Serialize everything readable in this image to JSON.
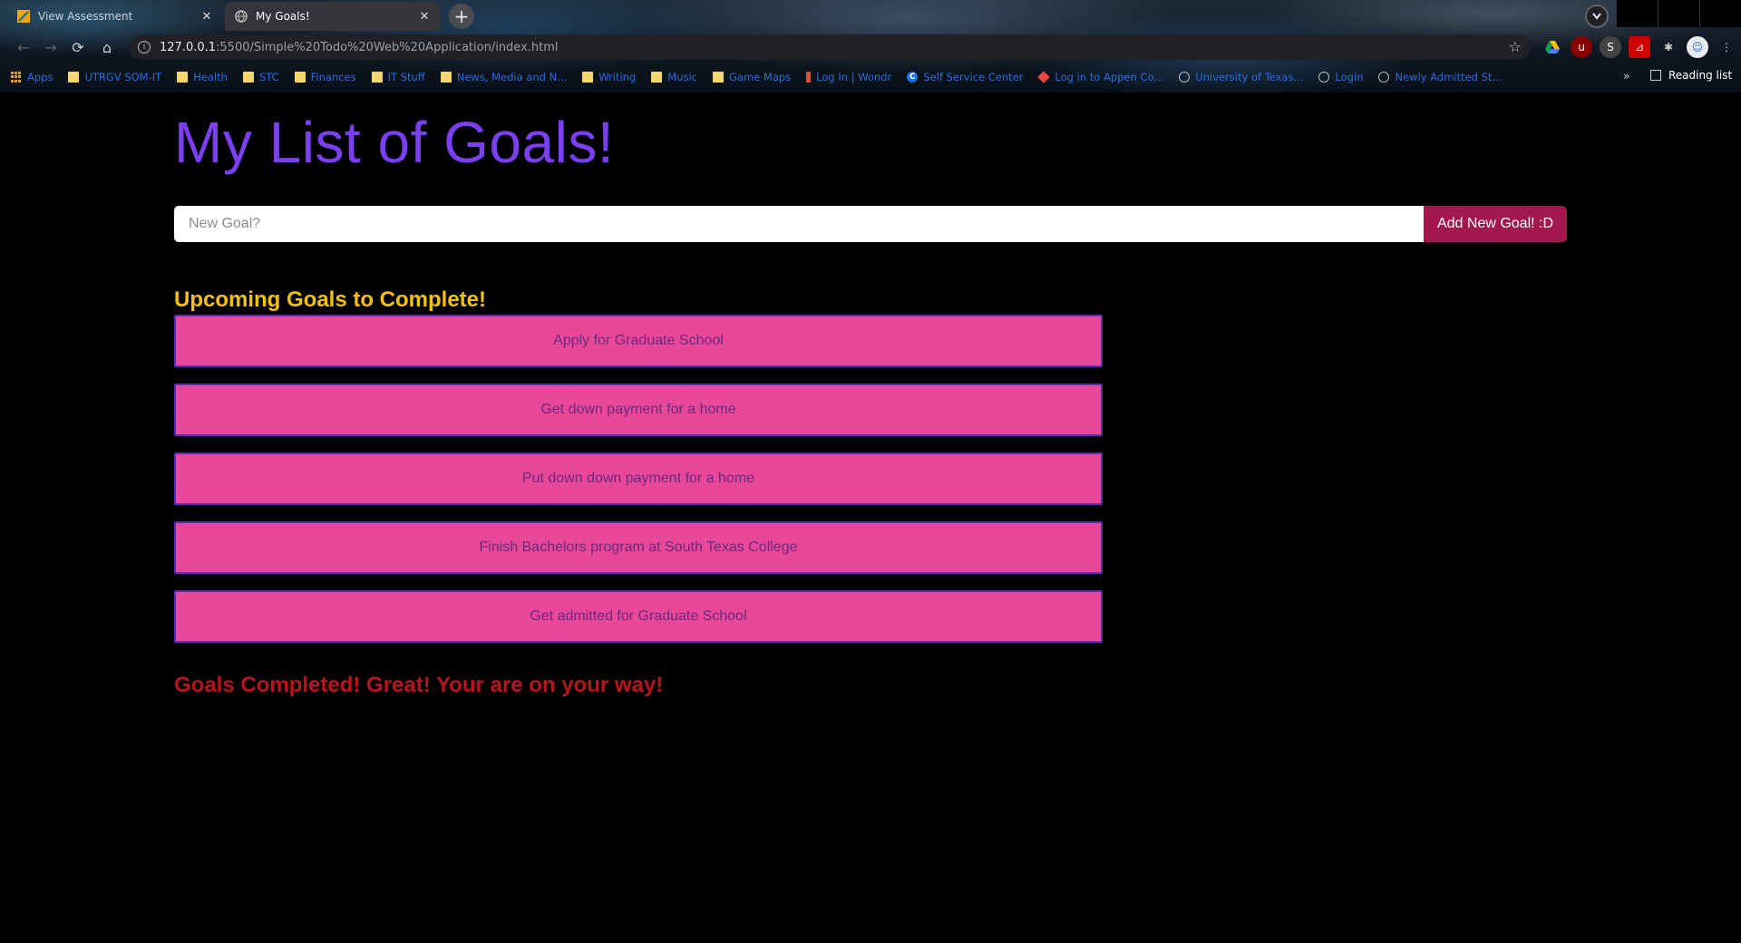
{
  "browser": {
    "tabs": [
      {
        "title": "View Assessment",
        "active": false,
        "icon": "assessment-favicon"
      },
      {
        "title": "My Goals!",
        "active": true,
        "icon": "globe-favicon"
      }
    ],
    "url_host": "127.0.0.1",
    "url_rest": ":5500/Simple%20Todo%20Web%20Application/index.html",
    "bookmarks": [
      {
        "label": "Apps",
        "icon": "apps-grid"
      },
      {
        "label": "UTRGV SOM-IT",
        "icon": "folder"
      },
      {
        "label": "Health",
        "icon": "folder"
      },
      {
        "label": "STC",
        "icon": "folder"
      },
      {
        "label": "Finances",
        "icon": "folder"
      },
      {
        "label": "IT Stuff",
        "icon": "folder"
      },
      {
        "label": "News, Media and N...",
        "icon": "folder"
      },
      {
        "label": "Writing",
        "icon": "folder"
      },
      {
        "label": "Music",
        "icon": "folder"
      },
      {
        "label": "Game Maps",
        "icon": "folder"
      },
      {
        "label": "Log In | Wondr",
        "icon": "bar"
      },
      {
        "label": "Self Service Center",
        "icon": "c-circle"
      },
      {
        "label": "Log in to Appen Co...",
        "icon": "diamond"
      },
      {
        "label": "University of Texas...",
        "icon": "globe"
      },
      {
        "label": "Login",
        "icon": "globe"
      },
      {
        "label": "Newly Admitted St...",
        "icon": "globe"
      }
    ],
    "bookmarks_overflow": "»",
    "reading_list": "Reading list"
  },
  "page": {
    "heading": "My List of Goals!",
    "input_placeholder": "New Goal?",
    "input_value": "",
    "add_button": "Add New Goal! :D",
    "upcoming_title": "Upcoming Goals to Complete!",
    "goals": [
      "Apply for Graduate School",
      "Get down payment for a home",
      "Put down down payment for a home",
      "Finish Bachelors program at South Texas College",
      "Get admitted for Graduate School"
    ],
    "completed_title": "Goals Completed! Great! Your are on your way!"
  },
  "colors": {
    "heading": "#7b3ff2",
    "upcoming_title": "#f4c20d",
    "goal_bg": "#e9489a",
    "goal_border": "#5b2bb5",
    "add_button_bg": "#a3174f",
    "completed_title": "#b8141e"
  }
}
